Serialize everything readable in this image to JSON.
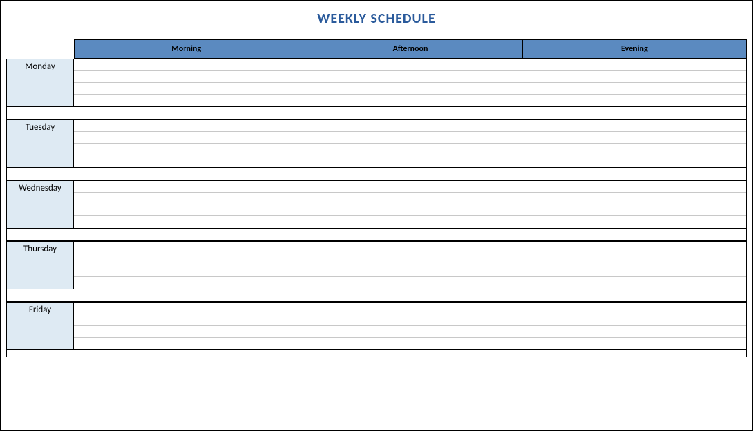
{
  "title": "WEEKLY SCHEDULE",
  "columns": [
    "Morning",
    "Afternoon",
    "Evening"
  ],
  "days": [
    "Monday",
    "Tuesday",
    "Wednesday",
    "Thursday",
    "Friday"
  ],
  "rows_per_day": 4,
  "colors": {
    "header_bg": "#5b8ac0",
    "day_bg": "#deeaf3",
    "title_color": "#2a5a9b"
  }
}
